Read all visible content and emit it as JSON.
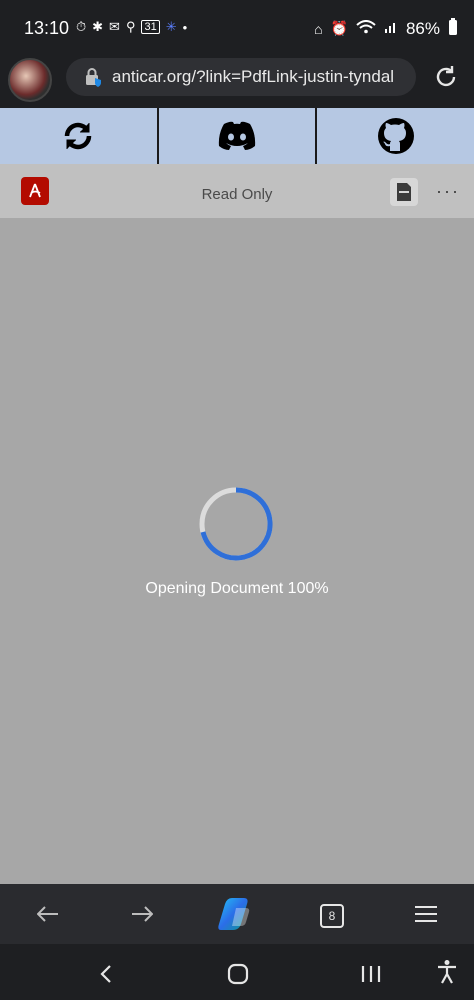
{
  "status_bar": {
    "time": "13:10",
    "battery": "86%",
    "calendar_badge": "31",
    "dot": "•"
  },
  "address_bar": {
    "url": "anticar.org/?link=PdfLink-justin-tyndal"
  },
  "site_bar": {
    "buttons": [
      {
        "name": "sync-icon"
      },
      {
        "name": "discord-icon"
      },
      {
        "name": "github-icon"
      }
    ]
  },
  "pdf_toolbar": {
    "title": "Read Only",
    "more": "···"
  },
  "document": {
    "status": "Opening Document 100%"
  },
  "browser_nav": {
    "tab_count": "8"
  },
  "colors": {
    "site_bar": "#b6c8e3",
    "pdf_toolbar": "#c0c0c0",
    "canvas": "#a7a7a7",
    "spinner": "#2f6fd8",
    "adobe": "#b30b00"
  }
}
